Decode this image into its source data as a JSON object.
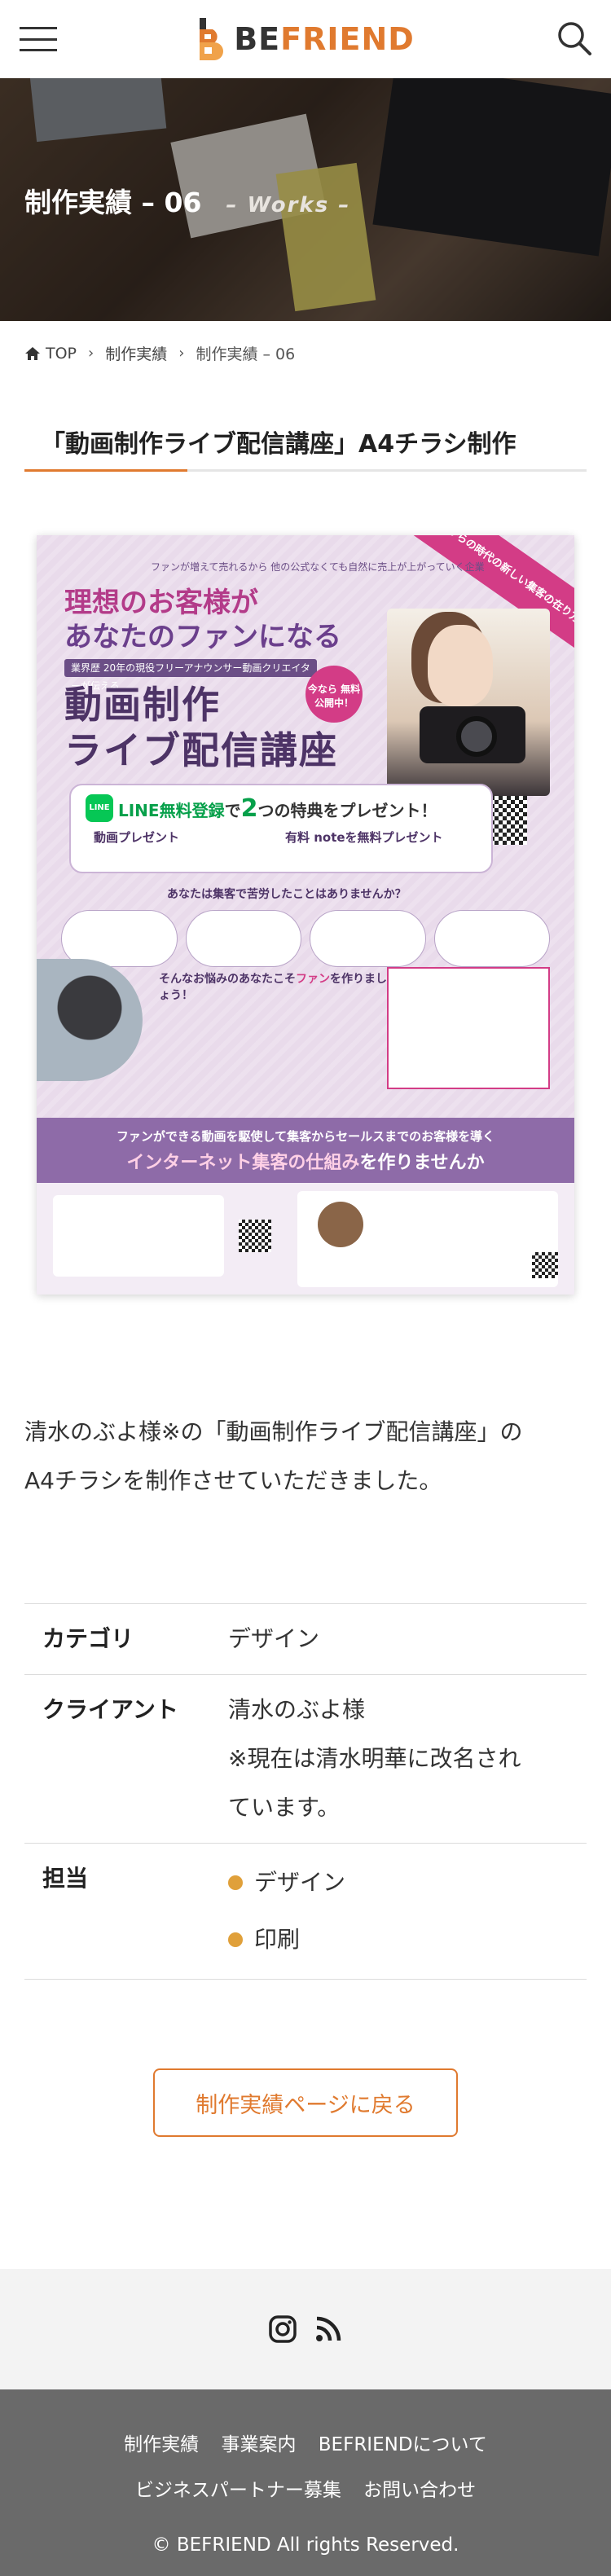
{
  "header": {
    "brand_be": "BE",
    "brand_friend": "FRIEND",
    "brand_initial": "B",
    "accent_color": "#e07a2f"
  },
  "hero": {
    "title": "制作実績 – 06",
    "subtitle": "– Works –"
  },
  "breadcrumb": {
    "items": [
      "TOP",
      "制作実績",
      "制作実績 – 06"
    ]
  },
  "page": {
    "title": "「動画制作ライブ配信講座」A4チラシ制作",
    "description_line1": "清水のぶよ様※の「動画制作ライブ配信講座」の",
    "description_line2": "A4チラシを制作させていただきました。"
  },
  "flyer": {
    "tagline": "ファンが増えて売れるから 他の公式なくても自然に売上が上がっていく企業",
    "headline_1": "理想のお客様が",
    "headline_2": "あなたのファンになる",
    "sub_bar": "業界歴 20年の現役フリーアナウンサー動画クリエイターが伝える",
    "main_title_1": "動画制作",
    "main_title_2": "ライブ配信講座",
    "badge": "今なら 無料公開中！",
    "ribbon": "これからの時代の新しい集客の在り方",
    "line_prefix": "LINE無料登録",
    "line_mid": "で",
    "line_num": "2",
    "line_suffix": "つの特典をプレゼント！",
    "perk1": "動画プレゼント",
    "perk2": "有料 noteを無料プレゼント",
    "question": "あなたは集客で苦労したことはありませんか？",
    "mid_1": "そんなお悩みのあなたこそ",
    "mid_2": "ファン",
    "mid_3": "を作りましょう！",
    "band_1": "ファンができる動画を駆使して集客からセールスまでのお客様を導く",
    "band_2": "インターネット集客の仕組み",
    "band_3": "を作りませんか"
  },
  "info": {
    "rows": [
      {
        "label": "カテゴリ",
        "value": "デザイン"
      },
      {
        "label": "クライアント",
        "value_line1": "清水のぶよ様",
        "value_line2": "※現在は清水明華に改名され",
        "value_line3": "ています。"
      },
      {
        "label": "担当",
        "tags": [
          "デザイン",
          "印刷"
        ]
      }
    ]
  },
  "actions": {
    "back_label": "制作実績ページに戻る"
  },
  "social": {
    "icons": [
      "instagram-icon",
      "rss-icon"
    ]
  },
  "footer": {
    "nav_row1": [
      "制作実績",
      "事業案内",
      "BEFRIENDについて"
    ],
    "nav_row2": [
      "ビジネスパートナー募集",
      "お問い合わせ"
    ],
    "copyright": "© BEFRIEND All rights Reserved."
  }
}
